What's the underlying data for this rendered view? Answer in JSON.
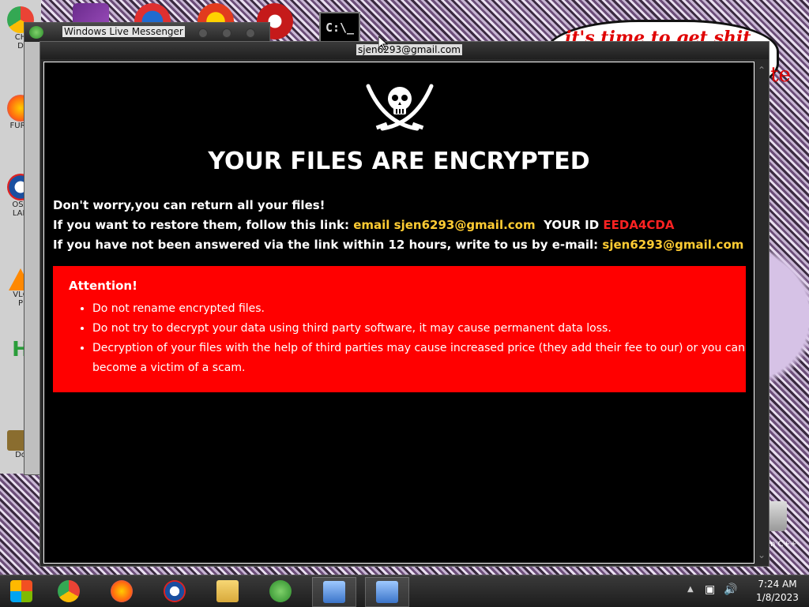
{
  "desktop": {
    "left_icons": [
      {
        "label": "CH\nD",
        "icon": "chrome-icon"
      },
      {
        "label": "FURR",
        "icon": "firefox-icon"
      },
      {
        "label": "OSA\nLAD",
        "icon": "shield-icon"
      },
      {
        "label": "VLC\nP",
        "icon": "vlc-icon"
      },
      {
        "label": "H",
        "icon": "app-icon"
      },
      {
        "label": "Do",
        "icon": "folder-icon"
      }
    ],
    "bubble_text": "it's time to get shit",
    "bubble_tail": "te",
    "recycle_label": "n C++"
  },
  "messenger": {
    "title": "Windows Live Messenger"
  },
  "cmd_icon": {
    "text": "C:\\_"
  },
  "ransom": {
    "window_title": "sjen6293@gmail.com",
    "headline": "YOUR FILES ARE ENCRYPTED",
    "line1": "Don't worry,you can return all your files!",
    "line2_prefix": "If you want to restore them, follow this link:",
    "line2_link": "email sjen6293@gmail.com",
    "line2_id_label": "YOUR ID",
    "line2_id": "EEDA4CDA",
    "line3_prefix": "If you have not been answered via the link within 12 hours, write to us by e-mail:",
    "line3_email": "sjen6293@gmail.com",
    "attention_title": "Attention!",
    "attention_items": [
      "Do not rename encrypted files.",
      "Do not try to decrypt your data using third party software, it may cause permanent data loss.",
      "Decryption of your files with the help of third parties may cause increased price (they add their fee to our) or you can become a victim of a scam."
    ]
  },
  "taskbar": {
    "items": [
      {
        "name": "start-button",
        "icon": "windows-icon"
      },
      {
        "name": "chrome",
        "icon": "chrome-icon"
      },
      {
        "name": "firefox",
        "icon": "firefox-icon"
      },
      {
        "name": "obama-app",
        "icon": "obama-logo-icon"
      },
      {
        "name": "explorer",
        "icon": "folder-icon"
      },
      {
        "name": "messenger",
        "icon": "messenger-icon"
      },
      {
        "name": "network-app-1",
        "icon": "network-icon"
      },
      {
        "name": "network-app-2",
        "icon": "network-icon"
      }
    ],
    "clock_time": "7:24 AM",
    "clock_date": "1/8/2023"
  },
  "colors": {
    "accent_red": "#ff0000",
    "link_yellow": "#ffcc33",
    "id_red": "#ff2222"
  }
}
